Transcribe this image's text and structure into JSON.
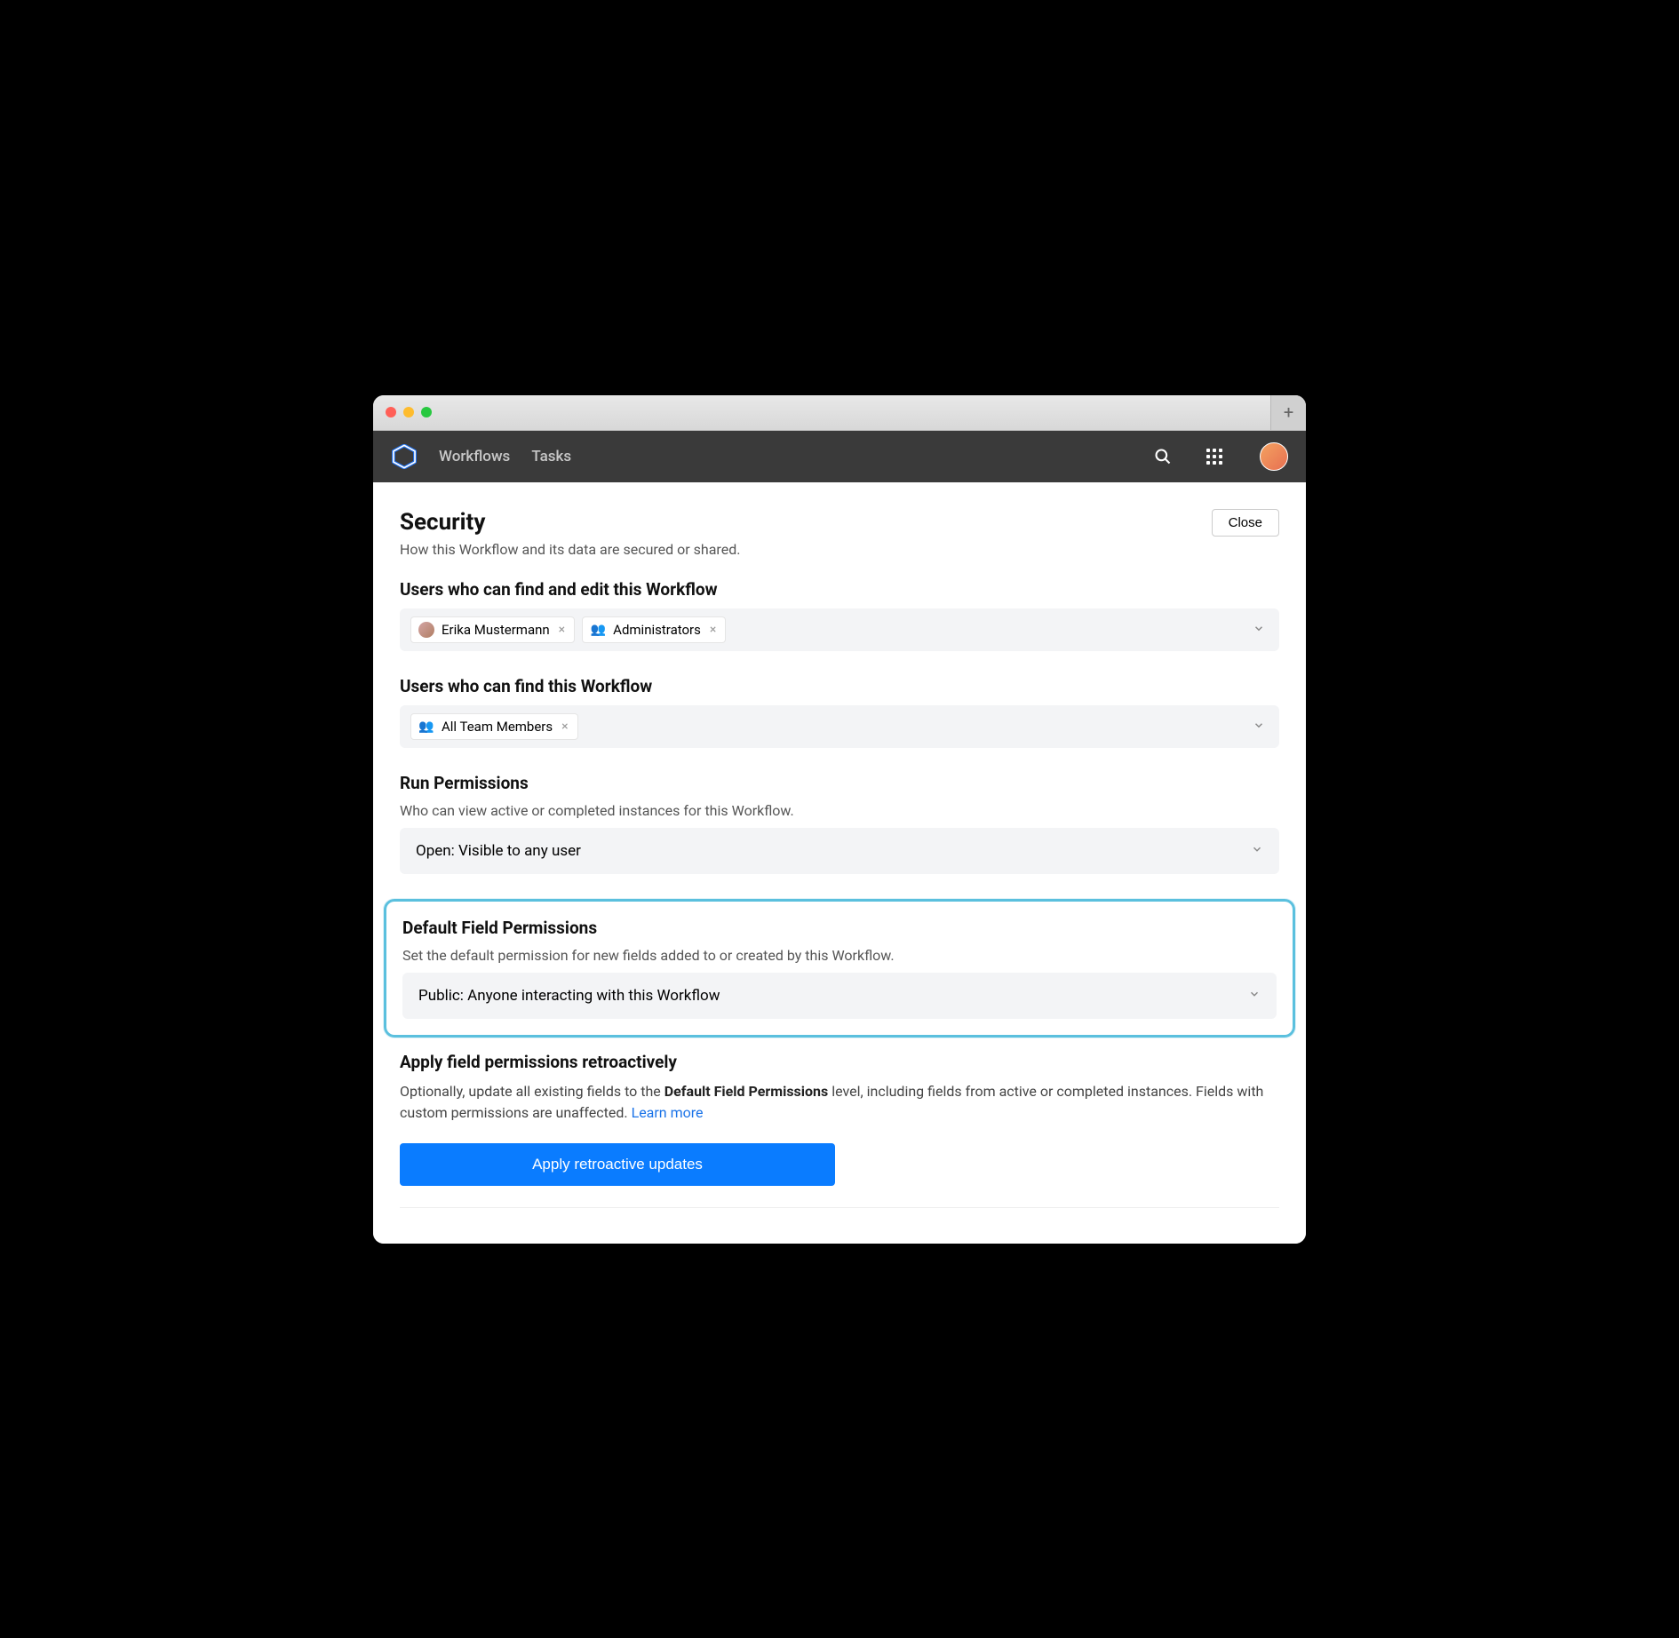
{
  "topbar": {
    "nav": {
      "workflows": "Workflows",
      "tasks": "Tasks"
    }
  },
  "header": {
    "title": "Security",
    "subtitle": "How this Workflow and its data are secured or shared.",
    "close_label": "Close"
  },
  "editors": {
    "heading": "Users who can find and edit this Workflow",
    "tags": [
      {
        "label": "Erika Mustermann",
        "type": "user"
      },
      {
        "label": "Administrators",
        "type": "group"
      }
    ]
  },
  "finders": {
    "heading": "Users who can find this Workflow",
    "tags": [
      {
        "label": "All Team Members",
        "type": "group"
      }
    ]
  },
  "run_permissions": {
    "heading": "Run Permissions",
    "subtext": "Who can view active or completed instances for this Workflow.",
    "value": "Open: Visible to any user"
  },
  "default_field_permissions": {
    "heading": "Default Field Permissions",
    "subtext": "Set the default permission for new fields added to or created by this Workflow.",
    "value": "Public: Anyone interacting with this Workflow"
  },
  "retroactive": {
    "heading": "Apply field permissions retroactively",
    "text_prefix": "Optionally, update all existing fields to the ",
    "text_bold": "Default Field Permissions",
    "text_suffix": " level, including fields from active or completed instances. Fields with custom permissions are unaffected. ",
    "learn_more": "Learn more",
    "button": "Apply retroactive updates"
  }
}
